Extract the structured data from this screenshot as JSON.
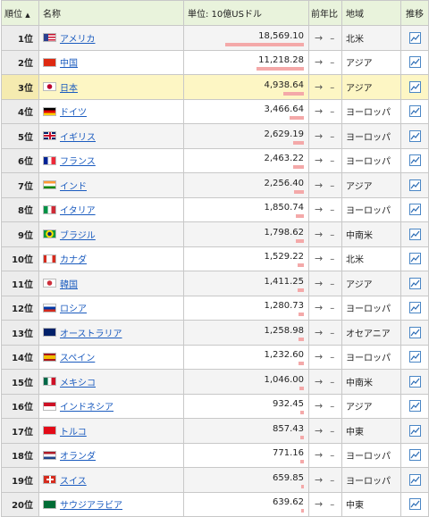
{
  "header": {
    "rank": "順位",
    "rank_sort": "▲",
    "name": "名称",
    "value": "単位: 10億USドル",
    "change": "前年比",
    "region": "地域",
    "trend": "推移"
  },
  "max_value": 18569.1,
  "rows": [
    {
      "rank": "1位",
      "flag": "us",
      "name": "アメリカ",
      "value": "18,569.10",
      "num": 18569.1,
      "arrow": "→",
      "change": "–",
      "region": "北米"
    },
    {
      "rank": "2位",
      "flag": "cn",
      "name": "中国",
      "value": "11,218.28",
      "num": 11218.28,
      "arrow": "→",
      "change": "–",
      "region": "アジア"
    },
    {
      "rank": "3位",
      "flag": "jp",
      "name": "日本",
      "value": "4,938.64",
      "num": 4938.64,
      "arrow": "→",
      "change": "–",
      "region": "アジア",
      "highlight": true
    },
    {
      "rank": "4位",
      "flag": "de",
      "name": "ドイツ",
      "value": "3,466.64",
      "num": 3466.64,
      "arrow": "→",
      "change": "–",
      "region": "ヨーロッパ"
    },
    {
      "rank": "5位",
      "flag": "gb",
      "name": "イギリス",
      "value": "2,629.19",
      "num": 2629.19,
      "arrow": "→",
      "change": "–",
      "region": "ヨーロッパ"
    },
    {
      "rank": "6位",
      "flag": "fr",
      "name": "フランス",
      "value": "2,463.22",
      "num": 2463.22,
      "arrow": "→",
      "change": "–",
      "region": "ヨーロッパ"
    },
    {
      "rank": "7位",
      "flag": "in",
      "name": "インド",
      "value": "2,256.40",
      "num": 2256.4,
      "arrow": "→",
      "change": "–",
      "region": "アジア"
    },
    {
      "rank": "8位",
      "flag": "it",
      "name": "イタリア",
      "value": "1,850.74",
      "num": 1850.74,
      "arrow": "→",
      "change": "–",
      "region": "ヨーロッパ"
    },
    {
      "rank": "9位",
      "flag": "br",
      "name": "ブラジル",
      "value": "1,798.62",
      "num": 1798.62,
      "arrow": "→",
      "change": "–",
      "region": "中南米"
    },
    {
      "rank": "10位",
      "flag": "ca",
      "name": "カナダ",
      "value": "1,529.22",
      "num": 1529.22,
      "arrow": "→",
      "change": "–",
      "region": "北米"
    },
    {
      "rank": "11位",
      "flag": "kr",
      "name": "韓国",
      "value": "1,411.25",
      "num": 1411.25,
      "arrow": "→",
      "change": "–",
      "region": "アジア"
    },
    {
      "rank": "12位",
      "flag": "ru",
      "name": "ロシア",
      "value": "1,280.73",
      "num": 1280.73,
      "arrow": "→",
      "change": "–",
      "region": "ヨーロッパ"
    },
    {
      "rank": "13位",
      "flag": "au",
      "name": "オーストラリア",
      "value": "1,258.98",
      "num": 1258.98,
      "arrow": "→",
      "change": "–",
      "region": "オセアニア"
    },
    {
      "rank": "14位",
      "flag": "es",
      "name": "スペイン",
      "value": "1,232.60",
      "num": 1232.6,
      "arrow": "→",
      "change": "–",
      "region": "ヨーロッパ"
    },
    {
      "rank": "15位",
      "flag": "mx",
      "name": "メキシコ",
      "value": "1,046.00",
      "num": 1046.0,
      "arrow": "→",
      "change": "–",
      "region": "中南米"
    },
    {
      "rank": "16位",
      "flag": "id",
      "name": "インドネシア",
      "value": "932.45",
      "num": 932.45,
      "arrow": "→",
      "change": "–",
      "region": "アジア"
    },
    {
      "rank": "17位",
      "flag": "tr",
      "name": "トルコ",
      "value": "857.43",
      "num": 857.43,
      "arrow": "→",
      "change": "–",
      "region": "中東"
    },
    {
      "rank": "18位",
      "flag": "nl",
      "name": "オランダ",
      "value": "771.16",
      "num": 771.16,
      "arrow": "→",
      "change": "–",
      "region": "ヨーロッパ"
    },
    {
      "rank": "19位",
      "flag": "ch",
      "name": "スイス",
      "value": "659.85",
      "num": 659.85,
      "arrow": "→",
      "change": "–",
      "region": "ヨーロッパ"
    },
    {
      "rank": "20位",
      "flag": "sa",
      "name": "サウジアラビア",
      "value": "639.62",
      "num": 639.62,
      "arrow": "→",
      "change": "–",
      "region": "中東"
    }
  ]
}
